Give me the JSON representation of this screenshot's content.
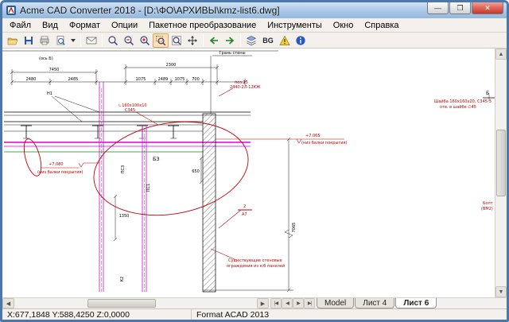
{
  "colors": {
    "magenta": "#e000e0",
    "red": "#c00000",
    "green": "#009000",
    "titlebar_top": "#cfe0f3",
    "titlebar_bottom": "#93b7dd",
    "close_red": "#c8372a"
  },
  "window": {
    "title": "Acme CAD Converter 2018 - [D:\\ФО\\АРХИВЫ\\kmz-list6.dwg]",
    "controls": {
      "minimize": "—",
      "maximize": "❐",
      "close": "✕"
    }
  },
  "menu": {
    "items": [
      {
        "label": "Файл"
      },
      {
        "label": "Вид"
      },
      {
        "label": "Формат"
      },
      {
        "label": "Опции"
      },
      {
        "label": "Пакетное преобразование"
      },
      {
        "label": "Инструменты"
      },
      {
        "label": "Окно"
      },
      {
        "label": "Справка"
      }
    ]
  },
  "toolbar": {
    "buttons": [
      {
        "name": "open"
      },
      {
        "name": "save"
      },
      {
        "name": "print"
      },
      {
        "name": "print-preview"
      },
      {
        "name": "export-dropdown"
      },
      {
        "name": "email"
      },
      {
        "name": "zoom-realtime"
      },
      {
        "name": "zoom-out"
      },
      {
        "name": "zoom-in"
      },
      {
        "name": "zoom-window",
        "pressed": true
      },
      {
        "name": "zoom-extents"
      },
      {
        "name": "pan"
      },
      {
        "name": "view-previous"
      },
      {
        "name": "view-next"
      },
      {
        "name": "layers"
      },
      {
        "name": "bg-toggle",
        "label": "BG"
      },
      {
        "name": "watermark"
      },
      {
        "name": "about"
      }
    ]
  },
  "drawing": {
    "texts": [
      {
        "t": "(ось Б)"
      },
      {
        "t": "7450"
      },
      {
        "t": "2300"
      },
      {
        "t": "2480"
      },
      {
        "t": "2485"
      },
      {
        "t": "1075"
      },
      {
        "t": "2489"
      },
      {
        "t": "1075"
      },
      {
        "t": "700"
      },
      {
        "t": "Грань стены"
      },
      {
        "t": "поз.15"
      },
      {
        "t": "2440-2Л-12КЖ"
      },
      {
        "t": "Н1"
      },
      {
        "t": "∟160х100х10"
      },
      {
        "t": "С345"
      },
      {
        "t": "Шайба 160х160х20, С345-3"
      },
      {
        "t": "отв. в шайбе ∅45"
      },
      {
        "t": "+7,065"
      },
      {
        "t": "(низ балки покрытия)"
      },
      {
        "t": "+7,080"
      },
      {
        "t": "(низ балки покрытия)"
      },
      {
        "t": "Б3"
      },
      {
        "t": "ПС3"
      },
      {
        "t": "ПС1"
      },
      {
        "t": "650"
      },
      {
        "t": "1350"
      },
      {
        "t": "7065"
      },
      {
        "t": "2"
      },
      {
        "t": "А7"
      },
      {
        "t": "Существующие стеновые"
      },
      {
        "t": "ограждения из к/б панелей"
      },
      {
        "t": "Болт"
      },
      {
        "t": "(ВМ2)"
      },
      {
        "t": "Б"
      },
      {
        "t": "К2"
      }
    ]
  },
  "scrollbars": {
    "up": "▲",
    "down": "▼",
    "left": "◀",
    "right": "▶"
  },
  "sheet_tabs": {
    "nav": [
      "|◀",
      "◀",
      "▶",
      "▶|"
    ],
    "items": [
      {
        "label": "Model",
        "active": false
      },
      {
        "label": "Лист 4",
        "active": false
      },
      {
        "label": "Лист 6",
        "active": true
      }
    ]
  },
  "statusbar": {
    "coords": "X:677,1848 Y:588,4250 Z:0,0000",
    "format": "Format ACAD 2013"
  }
}
